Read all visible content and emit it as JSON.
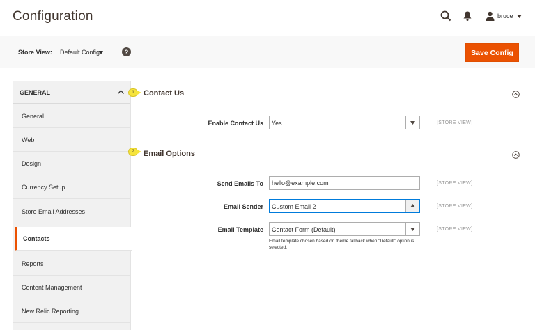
{
  "header": {
    "title": "Configuration",
    "user": "bruce"
  },
  "store_bar": {
    "label": "Store View:",
    "value": "Default Config",
    "save_label": "Save Config"
  },
  "sidebar": {
    "group_label": "GENERAL",
    "items": [
      {
        "label": "General"
      },
      {
        "label": "Web"
      },
      {
        "label": "Design"
      },
      {
        "label": "Currency Setup"
      },
      {
        "label": "Store Email Addresses"
      },
      {
        "label": "Contacts",
        "active": true
      },
      {
        "label": "Reports"
      },
      {
        "label": "Content Management"
      },
      {
        "label": "New Relic Reporting"
      }
    ]
  },
  "sections": {
    "contact_us": {
      "badge": "1",
      "title": "Contact Us",
      "enable_label": "Enable Contact Us",
      "enable_value": "Yes",
      "scope": "[STORE VIEW]"
    },
    "email_options": {
      "badge": "2",
      "title": "Email Options",
      "send_to_label": "Send Emails To",
      "send_to_value": "hello@example.com",
      "sender_label": "Email Sender",
      "sender_value": "Custom Email 2",
      "template_label": "Email Template",
      "template_value": "Contact Form (Default)",
      "template_note": "Email template chosen based on theme fallback when \"Default\" option is selected.",
      "scope": "[STORE VIEW]"
    }
  },
  "colors": {
    "accent": "#eb5202",
    "badge": "#f6e43c",
    "focus": "#007bdb"
  },
  "icons": {
    "search": "search-icon",
    "notifications": "bell-icon",
    "user": "user-icon",
    "help": "help-icon",
    "collapse": "collapse-icon"
  }
}
